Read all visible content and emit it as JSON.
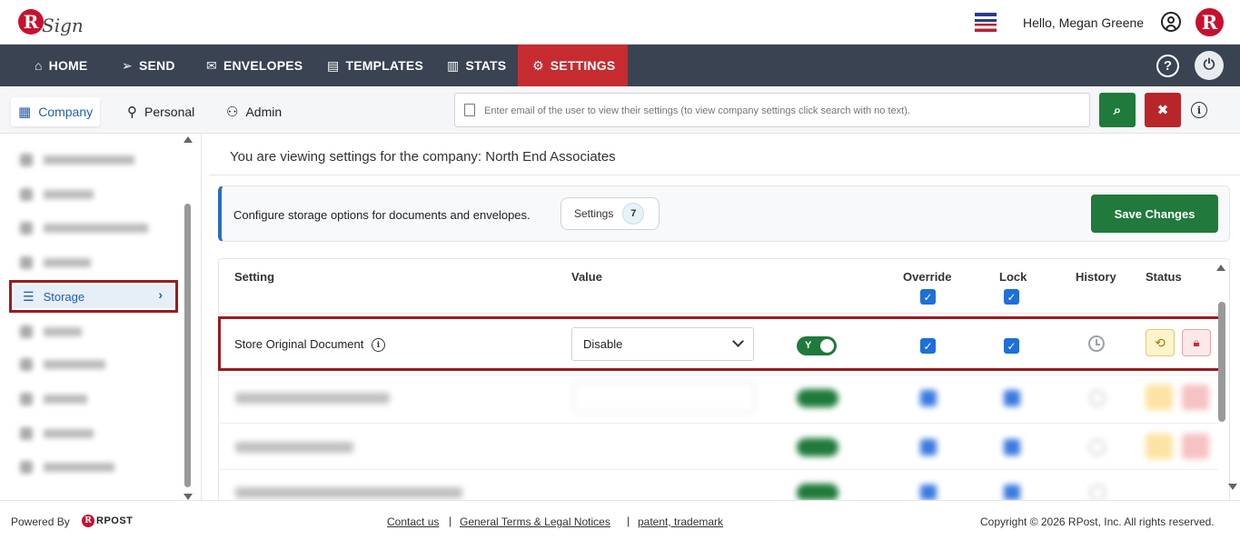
{
  "header": {
    "logo_letter": "R",
    "logo_text": "Sign",
    "greeting": "Hello, Megan Greene",
    "brand_letter": "R"
  },
  "nav": {
    "items": [
      {
        "label": "HOME",
        "icon": "home-icon"
      },
      {
        "label": "SEND",
        "icon": "send-icon"
      },
      {
        "label": "ENVELOPES",
        "icon": "envelope-icon"
      },
      {
        "label": "TEMPLATES",
        "icon": "template-icon"
      },
      {
        "label": "STATS",
        "icon": "chart-icon"
      },
      {
        "label": "SETTINGS",
        "icon": "gear-icon",
        "active": true
      }
    ],
    "help_glyph": "?",
    "active_color": "#c62c2f",
    "bar_color": "#3a4352"
  },
  "subtabs": {
    "company": "Company",
    "personal": "Personal",
    "admin": "Admin"
  },
  "search": {
    "placeholder": "Enter email of the user to view their settings (to view company settings click search with no text)."
  },
  "sidebar": {
    "active_item": "Storage"
  },
  "main": {
    "viewing_text": "You are viewing settings for the company: North End Associates",
    "description": "Configure storage options for documents and envelopes.",
    "settings_pill_label": "Settings",
    "settings_count": "7",
    "save_button": "Save Changes"
  },
  "table": {
    "headers": {
      "setting": "Setting",
      "value": "Value",
      "override": "Override",
      "lock": "Lock",
      "history": "History",
      "status": "Status"
    },
    "header_override_checked": true,
    "header_lock_checked": true,
    "rows": [
      {
        "label": "Store Original Document",
        "value": "Disable",
        "toggle_label": "Y",
        "override": true,
        "lock": true
      }
    ]
  },
  "footer": {
    "powered_by": "Powered By",
    "rpost": "RPOST",
    "links": [
      "Contact us",
      "General Terms & Legal Notices",
      "patent, trademark"
    ],
    "separator": "|",
    "copyright": "Copyright © 2026 RPost, Inc. All rights reserved."
  }
}
